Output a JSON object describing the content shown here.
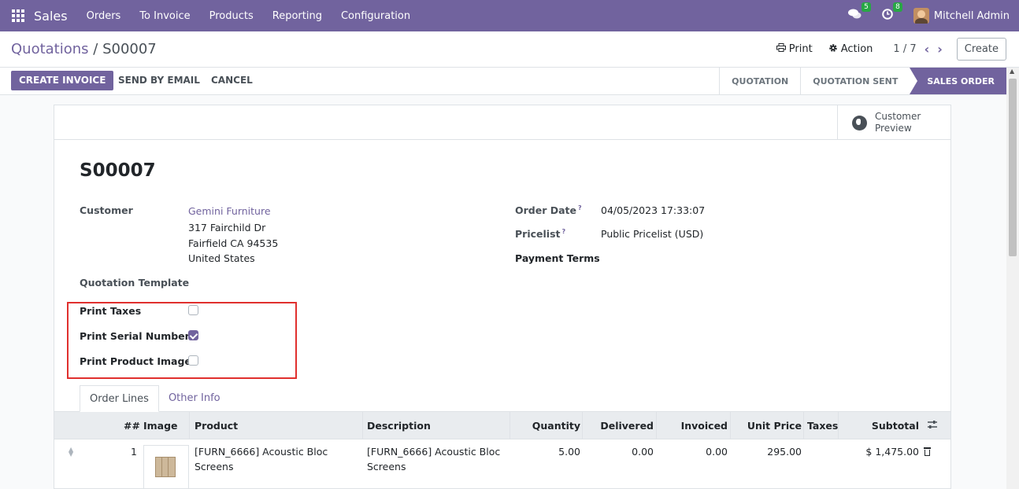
{
  "topbar": {
    "app_name": "Sales",
    "menus": [
      "Orders",
      "To Invoice",
      "Products",
      "Reporting",
      "Configuration"
    ],
    "messages_count": "5",
    "activities_count": "8",
    "user_name": "Mitchell Admin"
  },
  "control_panel": {
    "breadcrumb_parent": "Quotations",
    "breadcrumb_sep": " / ",
    "breadcrumb_current": "S00007",
    "print_label": "Print",
    "action_label": "Action",
    "pager": "1 / 7",
    "create_label": "Create"
  },
  "statusbar": {
    "create_invoice": "CREATE INVOICE",
    "send_by_email": "SEND BY EMAIL",
    "cancel": "CANCEL",
    "stages": [
      "QUOTATION",
      "QUOTATION SENT",
      "SALES ORDER"
    ],
    "active_stage": "SALES ORDER"
  },
  "form": {
    "customer_preview": "Customer Preview",
    "title": "S00007",
    "customer_label": "Customer",
    "customer_name": "Gemini Furniture",
    "customer_address": [
      "317 Fairchild Dr",
      "Fairfield CA 94535",
      "United States"
    ],
    "order_date_label": "Order Date",
    "order_date": "04/05/2023 17:33:07",
    "pricelist_label": "Pricelist",
    "pricelist": "Public Pricelist (USD)",
    "payment_terms_label": "Payment Terms",
    "help_mark": "?",
    "quotation_template_label": "Quotation Template",
    "print_taxes_label": "Print Taxes",
    "print_taxes": false,
    "print_serial_label": "Print Serial Number",
    "print_serial": true,
    "print_image_label": "Print Product Image",
    "print_image": false
  },
  "tabs": [
    "Order Lines",
    "Other Info"
  ],
  "table": {
    "headers": {
      "num": "##",
      "image": "Image",
      "product": "Product",
      "description": "Description",
      "quantity": "Quantity",
      "delivered": "Delivered",
      "invoiced": "Invoiced",
      "unit_price": "Unit Price",
      "taxes": "Taxes",
      "subtotal": "Subtotal"
    },
    "rows": [
      {
        "num": "1",
        "product": "[FURN_6666] Acoustic Bloc Screens",
        "description": "[FURN_6666] Acoustic Bloc Screens",
        "quantity": "5.00",
        "delivered": "0.00",
        "invoiced": "0.00",
        "unit_price": "295.00",
        "taxes": "",
        "subtotal": "$ 1,475.00"
      }
    ]
  },
  "colors": {
    "brand": "#71639e",
    "highlight": "#e0302e",
    "badge": "#28a745"
  }
}
